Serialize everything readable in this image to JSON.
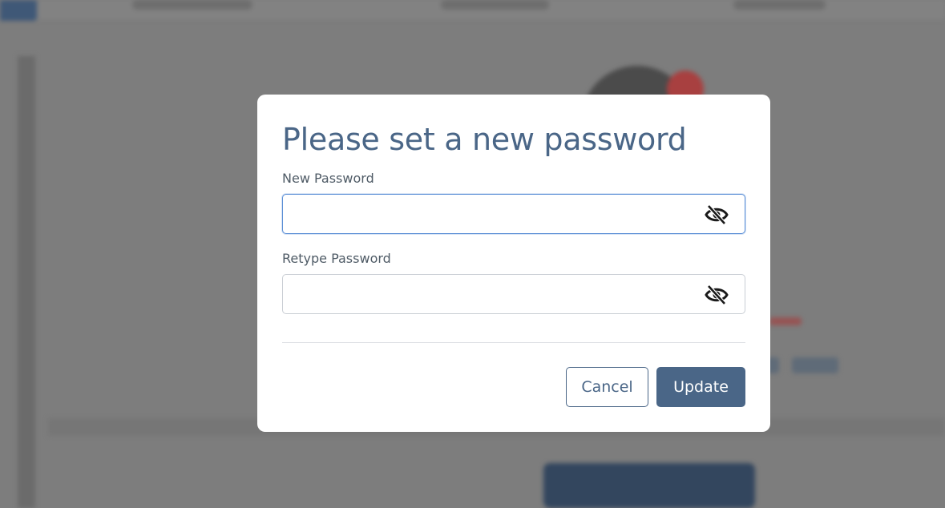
{
  "modal": {
    "title": "Please set a new password",
    "new_password": {
      "label": "New Password",
      "value": "",
      "placeholder": "",
      "toggle_icon": "eye-slash-icon"
    },
    "retype_password": {
      "label": "Retype Password",
      "value": "",
      "placeholder": "",
      "toggle_icon": "eye-slash-icon"
    },
    "cancel_label": "Cancel",
    "update_label": "Update"
  },
  "colors": {
    "accent": "#4a6687",
    "focus_border": "#5b8fd6",
    "overlay": "#7d7d7d"
  }
}
